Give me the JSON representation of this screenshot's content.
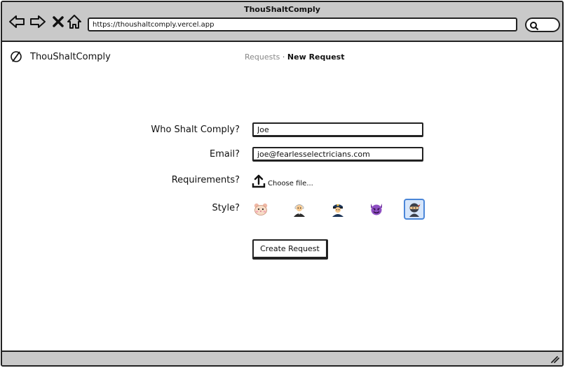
{
  "window": {
    "title": "ThouShaltComply"
  },
  "browser": {
    "url": "https://thoushaltcomply.vercel.app",
    "nav_icons": [
      "back-arrow-icon",
      "forward-arrow-icon",
      "close-x-icon",
      "home-icon"
    ],
    "search_icon": "search-icon"
  },
  "app": {
    "brand": "ThouShaltComply",
    "logo_icon": "circle-slash-icon"
  },
  "breadcrumb": {
    "parent": "Requests",
    "separator": "·",
    "current": "New Request"
  },
  "form": {
    "name_label": "Who Shalt Comply?",
    "name_value": "Joe",
    "email_label": "Email?",
    "email_value": "joe@fearlesselectricians.com",
    "requirements_label": "Requirements?",
    "file_button": "Choose file...",
    "file_icon": "upload-icon",
    "style_label": "Style?",
    "style_options": [
      {
        "icon": "hamster-face-icon",
        "selected": false
      },
      {
        "icon": "judge-icon",
        "selected": false
      },
      {
        "icon": "police-officer-icon",
        "selected": false
      },
      {
        "icon": "smiling-devil-icon",
        "selected": false
      },
      {
        "icon": "ninja-icon",
        "selected": true
      }
    ],
    "submit_label": "Create Request"
  },
  "colors": {
    "selected_border": "#4a86d8",
    "selected_fill": "#d6e6fb",
    "chrome": "#c9c9c9"
  }
}
